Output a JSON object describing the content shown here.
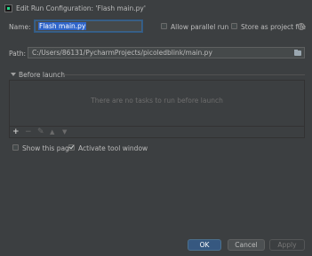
{
  "window": {
    "title": "Edit Run Configuration: 'Flash main.py'"
  },
  "name": {
    "label": "Name:",
    "value": "Flash main.py"
  },
  "options": {
    "allow_parallel_run": {
      "label": "Allow parallel run",
      "checked": false
    },
    "store_as_project_file": {
      "label": "Store as project file",
      "checked": false
    }
  },
  "help": {
    "glyph": "?"
  },
  "path": {
    "label": "Path:",
    "value": "C:/Users/86131/PycharmProjects/picoledblink/main.py"
  },
  "before_launch": {
    "title": "Before launch",
    "empty_text": "There are no tasks to run before launch",
    "toolbar": {
      "add": "+",
      "remove": "−",
      "edit": "✎",
      "up": "▲",
      "down": "▼"
    }
  },
  "footer_options": {
    "show_this_page": {
      "label": "Show this page",
      "checked": false
    },
    "activate_tool_window": {
      "label": "Activate tool window",
      "checked": true
    }
  },
  "buttons": {
    "ok": "OK",
    "cancel": "Cancel",
    "apply": "Apply"
  }
}
